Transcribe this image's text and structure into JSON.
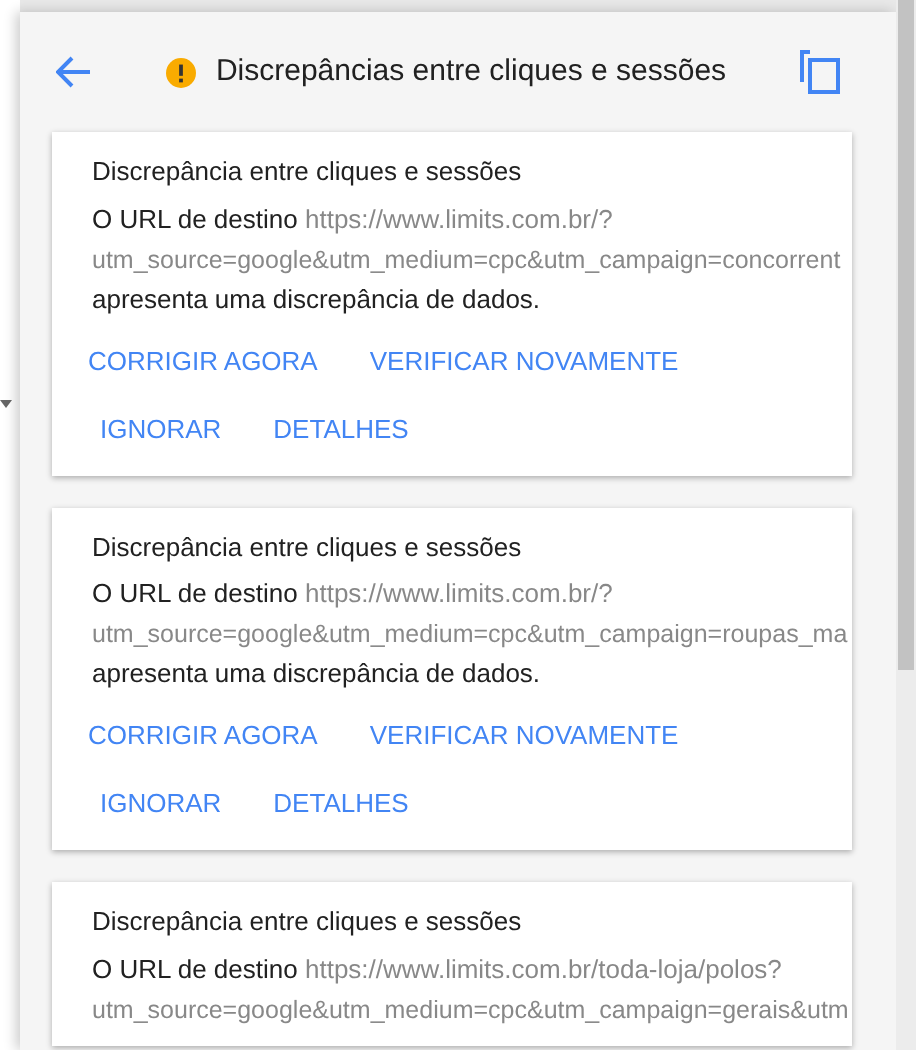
{
  "header": {
    "title": "Discrepâncias entre cliques e sessões"
  },
  "cards": [
    {
      "title": "Discrepância entre cliques e sessões",
      "lead": "O URL de destino",
      "url_lines": [
        "https://www.limits.com.br/?",
        "utm_source=google&utm_medium=cpc&utm_campaign=concorrent"
      ],
      "tail": "apresenta uma discrepância de dados.",
      "actions": [
        [
          "CORRIGIR AGORA",
          "VERIFICAR NOVAMENTE"
        ],
        [
          "IGNORAR",
          "DETALHES"
        ]
      ]
    },
    {
      "title": "Discrepância entre cliques e sessões",
      "lead": "O URL de destino",
      "url_lines": [
        "https://www.limits.com.br/?",
        "utm_source=google&utm_medium=cpc&utm_campaign=roupas_ma"
      ],
      "tail": "apresenta uma discrepância de dados.",
      "actions": [
        [
          "CORRIGIR AGORA",
          "VERIFICAR NOVAMENTE"
        ],
        [
          "IGNORAR",
          "DETALHES"
        ]
      ]
    },
    {
      "title": "Discrepância entre cliques e sessões",
      "lead": "O URL de destino",
      "url_lines": [
        "https://www.limits.com.br/toda-loja/polos?",
        "utm_source=google&utm_medium=cpc&utm_campaign=gerais&utm"
      ]
    }
  ]
}
